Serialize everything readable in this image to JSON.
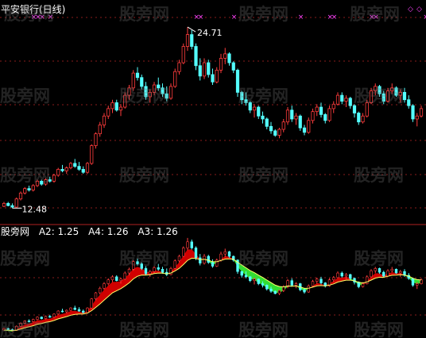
{
  "upper_title": "平安银行(日线)",
  "lower_header": {
    "name": "股旁网",
    "a2": "A2: 1.25",
    "a4": "A4: 1.26",
    "a3": "A3: 1.26"
  },
  "watermark": "股旁网",
  "colors": {
    "background": "#000000",
    "up": "#ff3c3c",
    "down": "#54ffff",
    "band_red": "#d00000",
    "band_green": "#33dd33",
    "line_yellow": "#ffff66",
    "marker": "#ff44ff",
    "gridline": "#8a1c1c"
  },
  "chart_data": [
    {
      "type": "candlestick",
      "title": "平安银行(日线)",
      "annotations": [
        {
          "text": "24.71",
          "kind": "high",
          "value": 24.71
        },
        {
          "text": "12.48",
          "kind": "low",
          "value": 12.48
        }
      ],
      "ylim": [
        11.8,
        26.0
      ],
      "grid": "horizontal dotted",
      "candles": [
        [
          12.6,
          12.9,
          12.55,
          12.8
        ],
        [
          12.8,
          12.9,
          12.6,
          12.65
        ],
        [
          12.65,
          12.8,
          12.48,
          12.55
        ],
        [
          12.55,
          13.2,
          12.5,
          13.1
        ],
        [
          13.1,
          13.6,
          13.0,
          13.5
        ],
        [
          13.5,
          13.9,
          13.4,
          13.8
        ],
        [
          13.8,
          14.0,
          13.6,
          13.7
        ],
        [
          13.7,
          14.1,
          13.6,
          14.0
        ],
        [
          14.0,
          14.4,
          13.9,
          14.3
        ],
        [
          14.3,
          14.4,
          14.0,
          14.1
        ],
        [
          14.1,
          14.5,
          14.0,
          14.4
        ],
        [
          14.4,
          14.6,
          14.2,
          14.3
        ],
        [
          14.3,
          14.8,
          14.2,
          14.7
        ],
        [
          14.7,
          15.2,
          14.6,
          15.1
        ],
        [
          15.1,
          15.4,
          14.9,
          15.0
        ],
        [
          15.0,
          15.3,
          14.8,
          15.2
        ],
        [
          15.2,
          15.6,
          15.1,
          15.5
        ],
        [
          15.5,
          15.8,
          15.2,
          15.3
        ],
        [
          15.3,
          15.6,
          15.0,
          15.1
        ],
        [
          15.1,
          15.3,
          14.8,
          14.9
        ],
        [
          14.9,
          15.6,
          14.8,
          15.5
        ],
        [
          15.5,
          16.8,
          15.4,
          16.7
        ],
        [
          16.7,
          17.6,
          16.5,
          17.5
        ],
        [
          17.5,
          18.3,
          17.3,
          18.1
        ],
        [
          18.1,
          18.9,
          17.9,
          18.7
        ],
        [
          18.7,
          19.4,
          18.5,
          19.2
        ],
        [
          19.2,
          19.8,
          18.9,
          19.6
        ],
        [
          19.6,
          19.8,
          19.0,
          19.1
        ],
        [
          19.1,
          19.5,
          18.7,
          19.3
        ],
        [
          19.3,
          20.3,
          19.2,
          20.1
        ],
        [
          20.1,
          20.8,
          19.8,
          20.6
        ],
        [
          20.6,
          21.8,
          20.4,
          21.6
        ],
        [
          21.6,
          22.0,
          21.1,
          21.3
        ],
        [
          21.3,
          21.5,
          20.5,
          20.7
        ],
        [
          20.7,
          21.0,
          19.8,
          20.0
        ],
        [
          20.0,
          20.5,
          19.6,
          20.3
        ],
        [
          20.3,
          21.0,
          20.1,
          20.8
        ],
        [
          20.8,
          21.3,
          20.4,
          20.6
        ],
        [
          20.6,
          20.9,
          20.0,
          20.2
        ],
        [
          20.2,
          20.7,
          19.7,
          19.9
        ],
        [
          19.9,
          20.9,
          19.8,
          20.7
        ],
        [
          20.7,
          21.9,
          20.6,
          21.7
        ],
        [
          21.7,
          22.5,
          21.5,
          22.3
        ],
        [
          22.3,
          23.6,
          22.2,
          23.4
        ],
        [
          23.4,
          24.71,
          23.1,
          24.2
        ],
        [
          24.2,
          24.5,
          23.2,
          23.4
        ],
        [
          23.4,
          23.6,
          21.8,
          22.1
        ],
        [
          22.1,
          22.6,
          21.1,
          21.4
        ],
        [
          21.4,
          22.6,
          21.2,
          22.3
        ],
        [
          22.3,
          22.5,
          21.3,
          21.5
        ],
        [
          21.5,
          21.9,
          20.8,
          21.0
        ],
        [
          21.0,
          22.0,
          20.9,
          21.8
        ],
        [
          21.8,
          22.9,
          21.6,
          22.6
        ],
        [
          22.6,
          23.3,
          22.2,
          22.9
        ],
        [
          22.9,
          23.0,
          22.1,
          22.3
        ],
        [
          22.3,
          22.4,
          21.6,
          21.8
        ],
        [
          21.8,
          21.9,
          20.0,
          20.3
        ],
        [
          20.3,
          20.4,
          19.5,
          19.8
        ],
        [
          19.8,
          20.3,
          19.4,
          19.6
        ],
        [
          19.6,
          19.7,
          18.9,
          19.1
        ],
        [
          19.1,
          19.5,
          18.6,
          19.3
        ],
        [
          19.3,
          19.4,
          18.5,
          18.7
        ],
        [
          18.7,
          19.0,
          18.2,
          18.5
        ],
        [
          18.5,
          18.6,
          17.8,
          18.0
        ],
        [
          18.0,
          18.3,
          17.5,
          17.7
        ],
        [
          17.7,
          17.8,
          17.3,
          17.4
        ],
        [
          17.4,
          17.9,
          17.2,
          17.8
        ],
        [
          17.8,
          18.5,
          17.6,
          18.3
        ],
        [
          18.3,
          19.3,
          18.1,
          19.1
        ],
        [
          19.1,
          19.4,
          18.3,
          18.5
        ],
        [
          18.5,
          18.9,
          18.1,
          18.7
        ],
        [
          18.7,
          18.8,
          17.7,
          17.9
        ],
        [
          17.9,
          18.1,
          17.4,
          17.6
        ],
        [
          17.6,
          18.6,
          17.5,
          18.4
        ],
        [
          18.4,
          19.2,
          18.2,
          19.0
        ],
        [
          19.0,
          19.5,
          18.7,
          19.3
        ],
        [
          19.3,
          19.6,
          18.6,
          18.8
        ],
        [
          18.8,
          18.9,
          18.2,
          18.4
        ],
        [
          18.4,
          19.4,
          18.3,
          19.2
        ],
        [
          19.2,
          19.7,
          18.9,
          19.5
        ],
        [
          19.5,
          20.3,
          19.4,
          20.1
        ],
        [
          20.1,
          20.3,
          19.5,
          19.7
        ],
        [
          19.7,
          20.1,
          19.3,
          19.9
        ],
        [
          19.9,
          20.0,
          19.2,
          19.4
        ],
        [
          19.4,
          19.5,
          18.6,
          18.9
        ],
        [
          18.9,
          19.0,
          18.1,
          18.3
        ],
        [
          18.3,
          18.9,
          18.2,
          18.7
        ],
        [
          18.7,
          19.8,
          18.6,
          19.6
        ],
        [
          19.6,
          20.6,
          19.5,
          20.4
        ],
        [
          20.4,
          20.9,
          20.1,
          20.7
        ],
        [
          20.7,
          20.8,
          20.0,
          20.2
        ],
        [
          20.2,
          20.4,
          19.5,
          19.7
        ],
        [
          19.7,
          20.6,
          19.6,
          20.4
        ],
        [
          20.4,
          20.9,
          20.2,
          20.6
        ],
        [
          20.6,
          20.7,
          20.0,
          20.1
        ],
        [
          20.1,
          20.5,
          19.6,
          20.3
        ],
        [
          20.3,
          20.6,
          19.6,
          19.8
        ],
        [
          19.8,
          20.1,
          19.2,
          19.4
        ],
        [
          19.4,
          19.5,
          18.3,
          18.5
        ],
        [
          18.5,
          18.9,
          18.0,
          18.7
        ],
        [
          18.7,
          19.4,
          18.6,
          19.2
        ]
      ],
      "markers_at_top": [
        7,
        8,
        9,
        11,
        46,
        47,
        55,
        71,
        78,
        79,
        88,
        89,
        101
      ]
    },
    {
      "type": "line",
      "title": "股旁网",
      "series": [
        {
          "name": "A2",
          "last": 1.25
        },
        {
          "name": "A4",
          "last": 1.26
        },
        {
          "name": "A3",
          "last": 1.26
        }
      ],
      "grid": "none"
    }
  ]
}
